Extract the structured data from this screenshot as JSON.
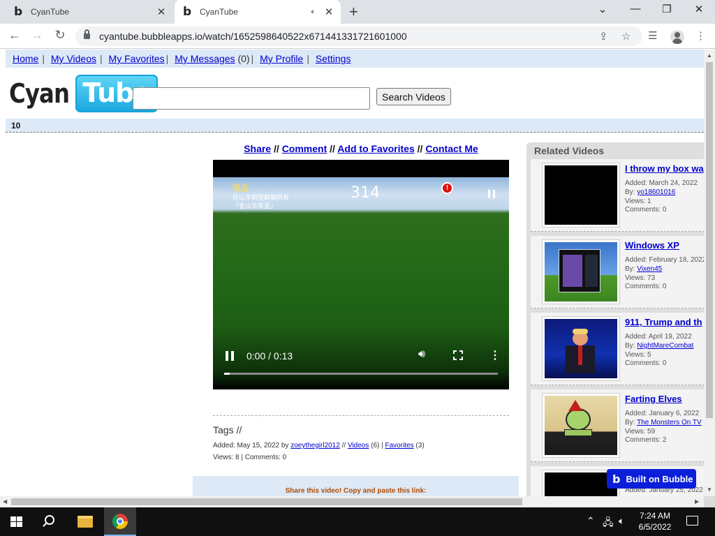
{
  "browser": {
    "tabs": [
      {
        "title": "CyanTube",
        "favicon": "b"
      },
      {
        "title": "CyanTube",
        "favicon": "b"
      }
    ],
    "url": "cyantube.bubbleapps.io/watch/1652598640522x671441331721601000"
  },
  "nav": {
    "home": "Home",
    "my_videos": "My Videos",
    "my_favorites": "My Favorites",
    "my_messages": "My Messages",
    "messages_count": "(0)",
    "my_profile": "My Profile",
    "settings": "Settings"
  },
  "logo": {
    "cyan": "Cyan",
    "tube": "Tube"
  },
  "search": {
    "value": "",
    "button": "Search Videos"
  },
  "count_strip": "10",
  "actions": {
    "share": "Share",
    "comment": "Comment",
    "favorites": "Add to Favorites",
    "contact": "Contact Me",
    "sep": "//"
  },
  "player": {
    "hud_title": "獎盃",
    "hud_line1": "在山羊類型解鎖所有",
    "hud_line2": "「金山羊獎盃」",
    "hud_score": "314",
    "alert": "!",
    "time": "0:00 / 0:13",
    "progress": 0.02
  },
  "video_info": {
    "tags": "Tags //",
    "added_prefix": "Added: May 15, 2022 by",
    "uploader": "zoeythegirl2012",
    "videos_link": "Videos",
    "videos_count": "(6)",
    "favorites_link": "Favorites",
    "favorites_count": "(3)",
    "views": "Views: 8 | Comments: 0",
    "share_prompt": "Share this video! Copy and paste this link:"
  },
  "related": {
    "title": "Related Videos",
    "items": [
      {
        "title": "I throw my box wa",
        "added": "Added: March 24, 2022",
        "by_label": "By:",
        "by": "yo18601016",
        "views": "Views: 1",
        "comments": "Comments: 0",
        "thumb": "black"
      },
      {
        "title": "Windows XP",
        "added": "Added: February 18, 2022",
        "by_label": "By:",
        "by": "Vixen45",
        "views": "Views: 73",
        "comments": "Comments: 0",
        "thumb": "xp"
      },
      {
        "title": "911, Trump and th",
        "added": "Added: April 19, 2022",
        "by_label": "By:",
        "by": "NightMareCombat",
        "views": "Views: 5",
        "comments": "Comments: 0",
        "thumb": "trump"
      },
      {
        "title": "Farting Elves",
        "added": "Added: January 6, 2022",
        "by_label": "By:",
        "by": "The Monsters On TV",
        "views": "Views: 59",
        "comments": "Comments: 2",
        "thumb": "cartoon"
      },
      {
        "title": "",
        "added": "Added: January 25, 2022",
        "by_label": "",
        "by": "",
        "views": "",
        "comments": "",
        "thumb": "black"
      }
    ]
  },
  "badge": {
    "label": "Built on Bubble",
    "icon": "b"
  },
  "taskbar": {
    "time": "7:24 AM",
    "date": "6/5/2022"
  }
}
